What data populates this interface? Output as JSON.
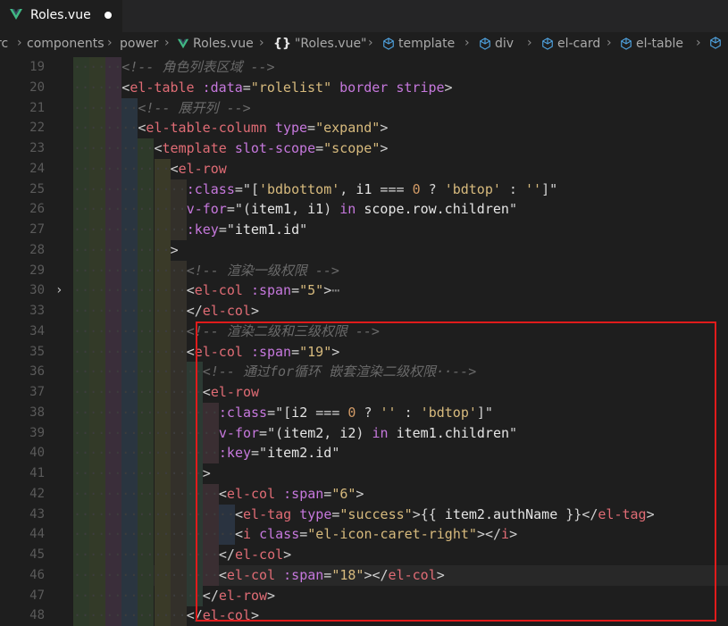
{
  "tab": {
    "title": "Roles.vue"
  },
  "breadcrumbs": [
    {
      "label": "rc",
      "icon": null
    },
    {
      "label": "components",
      "icon": null
    },
    {
      "label": "power",
      "icon": null
    },
    {
      "label": "Roles.vue",
      "icon": "vue-icon"
    },
    {
      "label": "\"Roles.vue\"",
      "icon": "braces-icon"
    },
    {
      "label": "template",
      "icon": "cube-icon"
    },
    {
      "label": "div",
      "icon": "cube-icon"
    },
    {
      "label": "el-card",
      "icon": "cube-icon"
    },
    {
      "label": "el-table",
      "icon": "cube-icon"
    }
  ],
  "colors": {
    "highlight_border": "#e01b1b",
    "vue_green": "#41b883"
  },
  "lines": [
    {
      "n": "19",
      "indent": 6,
      "tokens": [
        [
          "t-com",
          "<!-- 角色列表区域 -->"
        ]
      ]
    },
    {
      "n": "20",
      "indent": 6,
      "tokens": [
        [
          "t-br",
          "<"
        ],
        [
          "t-tag",
          "el-table"
        ],
        [
          "t-op",
          " "
        ],
        [
          "t-attr",
          ":data"
        ],
        [
          "t-op",
          "="
        ],
        [
          "t-str",
          "\"rolelist\""
        ],
        [
          "t-op",
          " "
        ],
        [
          "t-attr",
          "border"
        ],
        [
          "t-op",
          " "
        ],
        [
          "t-attr",
          "stripe"
        ],
        [
          "t-br",
          ">"
        ]
      ]
    },
    {
      "n": "21",
      "indent": 8,
      "tokens": [
        [
          "t-com",
          "<!-- 展开列 -->"
        ]
      ]
    },
    {
      "n": "22",
      "indent": 8,
      "tokens": [
        [
          "t-br",
          "<"
        ],
        [
          "t-tag",
          "el-table-column"
        ],
        [
          "t-op",
          " "
        ],
        [
          "t-attr",
          "type"
        ],
        [
          "t-op",
          "="
        ],
        [
          "t-str",
          "\"expand\""
        ],
        [
          "t-br",
          ">"
        ]
      ]
    },
    {
      "n": "23",
      "indent": 10,
      "tokens": [
        [
          "t-br",
          "<"
        ],
        [
          "t-tag",
          "template"
        ],
        [
          "t-op",
          " "
        ],
        [
          "t-attr",
          "slot-scope"
        ],
        [
          "t-op",
          "="
        ],
        [
          "t-str",
          "\"scope\""
        ],
        [
          "t-br",
          ">"
        ]
      ]
    },
    {
      "n": "24",
      "indent": 12,
      "tokens": [
        [
          "t-br",
          "<"
        ],
        [
          "t-tag",
          "el-row"
        ]
      ]
    },
    {
      "n": "25",
      "indent": 14,
      "tokens": [
        [
          "t-attr",
          ":class"
        ],
        [
          "t-op",
          "=\""
        ],
        [
          "t-op",
          "["
        ],
        [
          "t-str",
          "'bdbottom'"
        ],
        [
          "t-op",
          ", "
        ],
        [
          "t-var",
          "i1"
        ],
        [
          "t-op",
          " === "
        ],
        [
          "t-num",
          "0"
        ],
        [
          "t-op",
          " ? "
        ],
        [
          "t-str",
          "'bdtop'"
        ],
        [
          "t-op",
          " : "
        ],
        [
          "t-str",
          "''"
        ],
        [
          "t-op",
          "]\""
        ]
      ]
    },
    {
      "n": "26",
      "indent": 14,
      "tokens": [
        [
          "t-attr",
          "v-for"
        ],
        [
          "t-op",
          "=\""
        ],
        [
          "t-op",
          "("
        ],
        [
          "t-var",
          "item1"
        ],
        [
          "t-op",
          ", "
        ],
        [
          "t-var",
          "i1"
        ],
        [
          "t-op",
          ") "
        ],
        [
          "t-kw",
          "in"
        ],
        [
          "t-op",
          " "
        ],
        [
          "t-var",
          "scope.row.children"
        ],
        [
          "t-op",
          "\""
        ]
      ]
    },
    {
      "n": "27",
      "indent": 14,
      "tokens": [
        [
          "t-attr",
          ":key"
        ],
        [
          "t-op",
          "=\""
        ],
        [
          "t-var",
          "item1.id"
        ],
        [
          "t-op",
          "\""
        ]
      ]
    },
    {
      "n": "28",
      "indent": 12,
      "tokens": [
        [
          "t-br",
          ">"
        ]
      ]
    },
    {
      "n": "29",
      "indent": 14,
      "tokens": [
        [
          "t-com",
          "<!-- 渲染一级权限 -->"
        ]
      ]
    },
    {
      "n": "30",
      "indent": 14,
      "fold": true,
      "tokens": [
        [
          "t-br",
          "<"
        ],
        [
          "t-tag",
          "el-col"
        ],
        [
          "t-op",
          " "
        ],
        [
          "t-attr",
          ":span"
        ],
        [
          "t-op",
          "="
        ],
        [
          "t-str",
          "\"5\""
        ],
        [
          "t-br",
          ">"
        ],
        [
          "t-fold",
          "⋯"
        ]
      ]
    },
    {
      "n": "33",
      "indent": 14,
      "tokens": [
        [
          "t-br",
          "</"
        ],
        [
          "t-tag",
          "el-col"
        ],
        [
          "t-br",
          ">"
        ]
      ]
    },
    {
      "n": "34",
      "indent": 14,
      "tokens": [
        [
          "t-com",
          "<!-- 渲染二级和三级权限 -->"
        ]
      ]
    },
    {
      "n": "35",
      "indent": 14,
      "tokens": [
        [
          "t-br",
          "<"
        ],
        [
          "t-tag",
          "el-col"
        ],
        [
          "t-op",
          " "
        ],
        [
          "t-attr",
          ":span"
        ],
        [
          "t-op",
          "="
        ],
        [
          "t-str",
          "\"19\""
        ],
        [
          "t-br",
          ">"
        ]
      ]
    },
    {
      "n": "36",
      "indent": 16,
      "tokens": [
        [
          "t-com",
          "<!-- 通过for循环 嵌套渲染二级权限··-->"
        ]
      ]
    },
    {
      "n": "37",
      "indent": 16,
      "tokens": [
        [
          "t-br",
          "<"
        ],
        [
          "t-tag",
          "el-row"
        ]
      ]
    },
    {
      "n": "38",
      "indent": 18,
      "tokens": [
        [
          "t-attr",
          ":class"
        ],
        [
          "t-op",
          "=\""
        ],
        [
          "t-op",
          "["
        ],
        [
          "t-var",
          "i2"
        ],
        [
          "t-op",
          " === "
        ],
        [
          "t-num",
          "0"
        ],
        [
          "t-op",
          " ? "
        ],
        [
          "t-str",
          "''"
        ],
        [
          "t-op",
          " : "
        ],
        [
          "t-str",
          "'bdtop'"
        ],
        [
          "t-op",
          "]\""
        ]
      ]
    },
    {
      "n": "39",
      "indent": 18,
      "tokens": [
        [
          "t-attr",
          "v-for"
        ],
        [
          "t-op",
          "=\""
        ],
        [
          "t-op",
          "("
        ],
        [
          "t-var",
          "item2"
        ],
        [
          "t-op",
          ", "
        ],
        [
          "t-var",
          "i2"
        ],
        [
          "t-op",
          ") "
        ],
        [
          "t-kw",
          "in"
        ],
        [
          "t-op",
          " "
        ],
        [
          "t-var",
          "item1.children"
        ],
        [
          "t-op",
          "\""
        ]
      ]
    },
    {
      "n": "40",
      "indent": 18,
      "tokens": [
        [
          "t-attr",
          ":key"
        ],
        [
          "t-op",
          "=\""
        ],
        [
          "t-var",
          "item2.id"
        ],
        [
          "t-op",
          "\""
        ]
      ]
    },
    {
      "n": "41",
      "indent": 16,
      "tokens": [
        [
          "t-br",
          ">"
        ]
      ]
    },
    {
      "n": "42",
      "indent": 18,
      "tokens": [
        [
          "t-br",
          "<"
        ],
        [
          "t-tag",
          "el-col"
        ],
        [
          "t-op",
          " "
        ],
        [
          "t-attr",
          ":span"
        ],
        [
          "t-op",
          "="
        ],
        [
          "t-str",
          "\"6\""
        ],
        [
          "t-br",
          ">"
        ]
      ]
    },
    {
      "n": "43",
      "indent": 20,
      "tokens": [
        [
          "t-br",
          "<"
        ],
        [
          "t-tag",
          "el-tag"
        ],
        [
          "t-op",
          " "
        ],
        [
          "t-attr",
          "type"
        ],
        [
          "t-op",
          "="
        ],
        [
          "t-str",
          "\"success\""
        ],
        [
          "t-br",
          ">"
        ],
        [
          "t-op",
          "{{ "
        ],
        [
          "t-var",
          "item2.authName"
        ],
        [
          "t-op",
          " }}"
        ],
        [
          "t-br",
          "</"
        ],
        [
          "t-tag",
          "el-tag"
        ],
        [
          "t-br",
          ">"
        ]
      ]
    },
    {
      "n": "44",
      "indent": 20,
      "tokens": [
        [
          "t-br",
          "<"
        ],
        [
          "t-tag",
          "i"
        ],
        [
          "t-op",
          " "
        ],
        [
          "t-attr",
          "class"
        ],
        [
          "t-op",
          "="
        ],
        [
          "t-str",
          "\"el-icon-caret-right\""
        ],
        [
          "t-br",
          "></"
        ],
        [
          "t-tag",
          "i"
        ],
        [
          "t-br",
          ">"
        ]
      ]
    },
    {
      "n": "45",
      "indent": 18,
      "tokens": [
        [
          "t-br",
          "</"
        ],
        [
          "t-tag",
          "el-col"
        ],
        [
          "t-br",
          ">"
        ]
      ]
    },
    {
      "n": "46",
      "indent": 18,
      "current": true,
      "tokens": [
        [
          "t-br",
          "<"
        ],
        [
          "t-tag",
          "el-col"
        ],
        [
          "t-op",
          " "
        ],
        [
          "t-attr",
          ":span"
        ],
        [
          "t-op",
          "="
        ],
        [
          "t-str",
          "\"18\""
        ],
        [
          "t-br",
          "></"
        ],
        [
          "t-tag",
          "el-col"
        ],
        [
          "t-br",
          ">"
        ]
      ]
    },
    {
      "n": "47",
      "indent": 16,
      "tokens": [
        [
          "t-br",
          "</"
        ],
        [
          "t-tag",
          "el-row"
        ],
        [
          "t-br",
          ">"
        ]
      ]
    },
    {
      "n": "48",
      "indent": 14,
      "tokens": [
        [
          "t-br",
          "</"
        ],
        [
          "t-tag",
          "el-col"
        ],
        [
          "t-br",
          ">"
        ]
      ]
    }
  ]
}
